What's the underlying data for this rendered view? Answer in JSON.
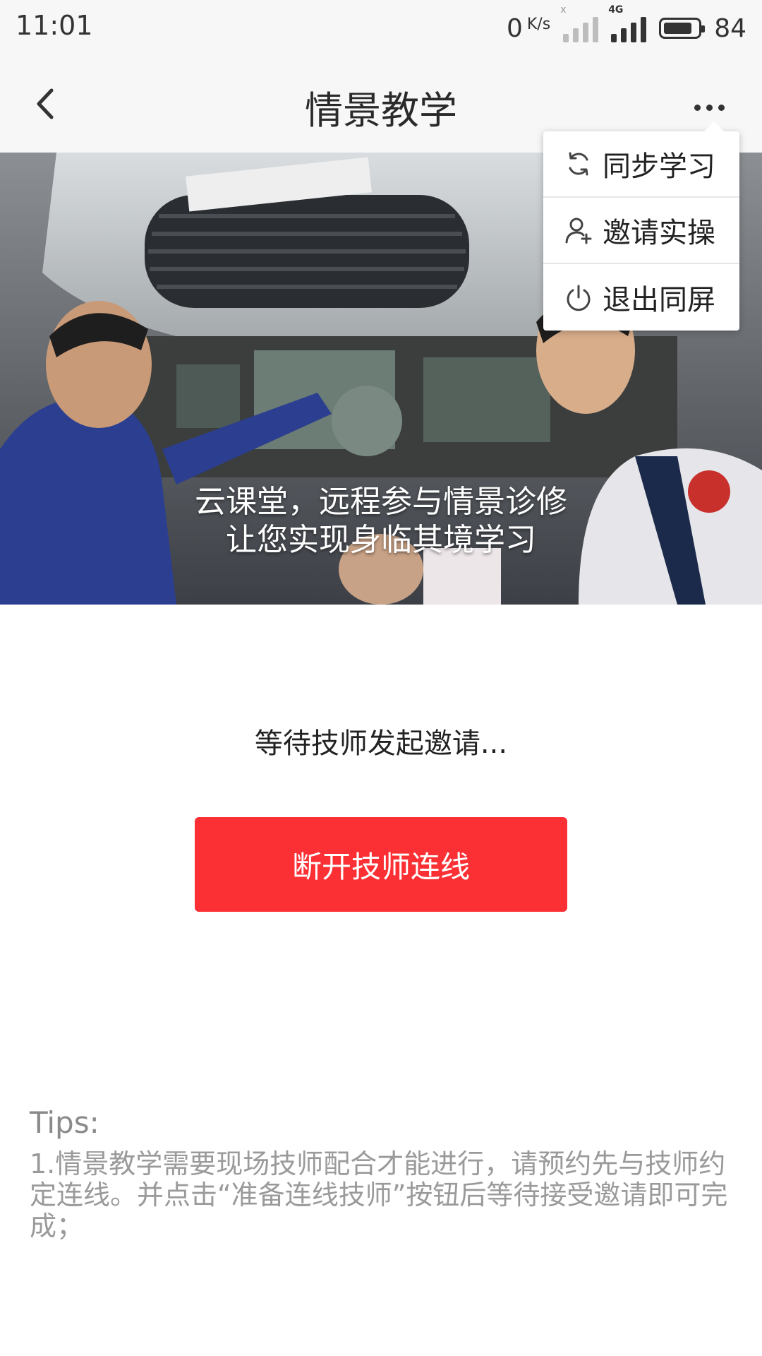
{
  "status_bar": {
    "time": "11:01",
    "net_speed_value": "0",
    "net_speed_unit": "K/s",
    "sim1_tag": "x",
    "sim2_tag": "4G",
    "battery_level": "84",
    "battery_fraction": 0.84
  },
  "nav": {
    "title": "情景教学",
    "back_icon": "chevron-left-icon",
    "more_icon": "more-horizontal-icon"
  },
  "menu": {
    "items": [
      {
        "label": "同步学习",
        "icon": "sync-icon"
      },
      {
        "label": "邀请实操",
        "icon": "add-user-icon"
      },
      {
        "label": "退出同屏",
        "icon": "power-icon"
      }
    ]
  },
  "hero": {
    "caption_line1": "云课堂，远程参与情景诊修",
    "caption_line2": "让您实现身临其境学习",
    "image_subject": "technicians inspecting electric car chassis"
  },
  "main": {
    "waiting_text": "等待技师发起邀请...",
    "disconnect_button": "断开技师连线"
  },
  "tips": {
    "title": "Tips:",
    "body": "1.情景教学需要现场技师配合才能进行，请预约先与技师约定连线。并点击“准备连线技师”按钮后等待接受邀请即可完成；"
  },
  "colors": {
    "accent": "#fb3035",
    "bar_bg": "#f7f7f7",
    "tips_text": "#9a9a9a"
  }
}
